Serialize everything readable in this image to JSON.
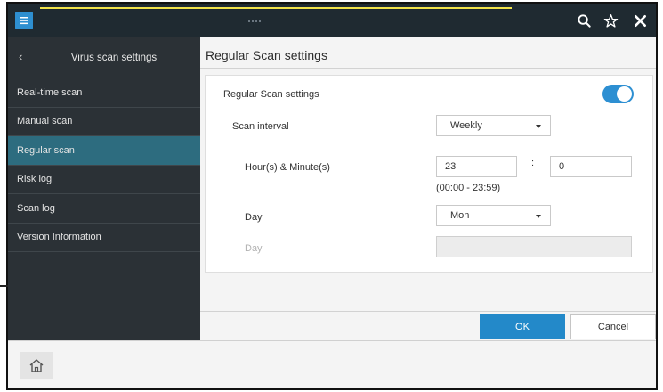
{
  "icons": {
    "menu": "hamburger-menu-icon",
    "search": "search-icon",
    "favorite": "star-icon",
    "close": "close-icon",
    "back": "chevron-left-icon",
    "home": "home-icon"
  },
  "colors": {
    "topbar": "#1f2a31",
    "sidebar": "#2b3136",
    "sidebar_active": "#2d6c7f",
    "accent": "#2389c9",
    "toggle_on": "#2d8fd2"
  },
  "sidebar": {
    "back_glyph": "‹",
    "title": "Virus scan settings",
    "items": [
      {
        "label": "Real-time scan",
        "active": false
      },
      {
        "label": "Manual scan",
        "active": false
      },
      {
        "label": "Regular scan",
        "active": true
      },
      {
        "label": "Risk log",
        "active": false
      },
      {
        "label": "Scan log",
        "active": false
      },
      {
        "label": "Version Information",
        "active": false
      }
    ]
  },
  "main": {
    "title": "Regular Scan settings",
    "form": {
      "enable_label": "Regular Scan settings",
      "enable_on": true,
      "interval_label": "Scan interval",
      "interval_value": "Weekly",
      "time_label": "Hour(s) & Minute(s)",
      "hour_value": "23",
      "time_separator": ":",
      "minute_value": "0",
      "time_hint": "(00:00 - 23:59)",
      "day_label": "Day",
      "day_value": "Mon",
      "day2_label": "Day",
      "day2_value": ""
    },
    "ok_label": "OK",
    "cancel_label": "Cancel"
  }
}
